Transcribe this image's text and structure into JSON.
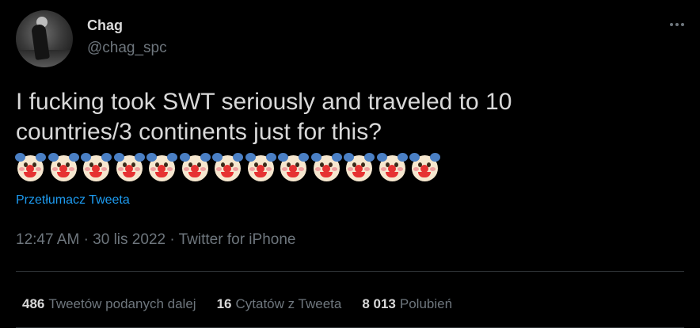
{
  "user": {
    "name": "Chag",
    "handle": "@chag_spc"
  },
  "tweet": {
    "text": "I fucking took SWT seriously and traveled to 10\ncountries/3 continents just for this?",
    "emoji_name": "clown-face-emoji",
    "emoji_count": 13,
    "translate_label": "Przetłumacz Tweeta",
    "time": "12:47 AM",
    "separator": "·",
    "date": "30 lis 2022",
    "source": "Twitter for iPhone"
  },
  "stats": {
    "retweets": {
      "count": "486",
      "label": "Tweetów podanych dalej"
    },
    "quotes": {
      "count": "16",
      "label": "Cytatów z Tweeta"
    },
    "likes": {
      "count": "8 013",
      "label": "Polubień"
    }
  },
  "colors": {
    "background": "#000000",
    "text": "#d9d9d9",
    "secondary": "#6e767d",
    "link": "#1d9bf0"
  }
}
